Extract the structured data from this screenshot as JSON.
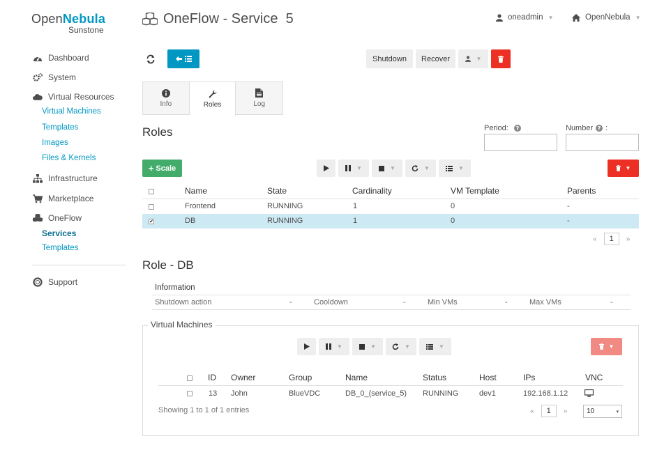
{
  "logo": {
    "part1": "Open",
    "part2": "Nebula",
    "subtitle": "Sunstone"
  },
  "sidebar": {
    "dashboard": "Dashboard",
    "system": "System",
    "virtual_resources": "Virtual Resources",
    "vr_items": [
      "Virtual Machines",
      "Templates",
      "Images",
      "Files & Kernels"
    ],
    "infrastructure": "Infrastructure",
    "marketplace": "Marketplace",
    "oneflow": "OneFlow",
    "oneflow_items": [
      "Services",
      "Templates"
    ],
    "support": "Support"
  },
  "header": {
    "title": "OneFlow - Service  5",
    "user": "oneadmin",
    "zone": "OpenNebula"
  },
  "toolbar": {
    "shutdown": "Shutdown",
    "recover": "Recover"
  },
  "tabs": [
    {
      "label": "Info",
      "icon": "info-icon"
    },
    {
      "label": "Roles",
      "icon": "wrench-icon"
    },
    {
      "label": "Log",
      "icon": "file-icon"
    }
  ],
  "roles": {
    "heading": "Roles",
    "period_label": "Period:",
    "number_label": "Number",
    "number_suffix": ":",
    "scale_label": "Scale",
    "columns": [
      "Name",
      "State",
      "Cardinality",
      "VM Template",
      "Parents"
    ],
    "rows": [
      {
        "name": "Frontend",
        "state": "RUNNING",
        "cardinality": "1",
        "vm_template": "0",
        "parents": "-",
        "selected": false
      },
      {
        "name": "DB",
        "state": "RUNNING",
        "cardinality": "1",
        "vm_template": "0",
        "parents": "-",
        "selected": true
      }
    ],
    "page": "1",
    "prev": "«",
    "next": "»"
  },
  "role_detail": {
    "heading": "Role - DB",
    "info_heading": "Information",
    "fields": [
      {
        "label": "Shutdown action",
        "value": "-"
      },
      {
        "label": "Cooldown",
        "value": "-"
      },
      {
        "label": "Min VMs",
        "value": "-"
      },
      {
        "label": "Max VMs",
        "value": "-"
      }
    ]
  },
  "vms": {
    "legend": "Virtual Machines",
    "columns": [
      "ID",
      "Owner",
      "Group",
      "Name",
      "Status",
      "Host",
      "IPs",
      "VNC"
    ],
    "rows": [
      {
        "id": "13",
        "owner": "John",
        "group": "BlueVDC",
        "name": "DB_0_(service_5)",
        "status": "RUNNING",
        "host": "dev1",
        "ips": "192.168.1.12"
      }
    ],
    "showing": "Showing 1 to 1 of 1 entries",
    "page": "1",
    "prev": "«",
    "next": "»",
    "page_size": "10"
  },
  "colors": {
    "accent": "#0098c3",
    "danger": "#ec3023",
    "success": "#43ac6a",
    "selected_row": "#cde9f3"
  }
}
